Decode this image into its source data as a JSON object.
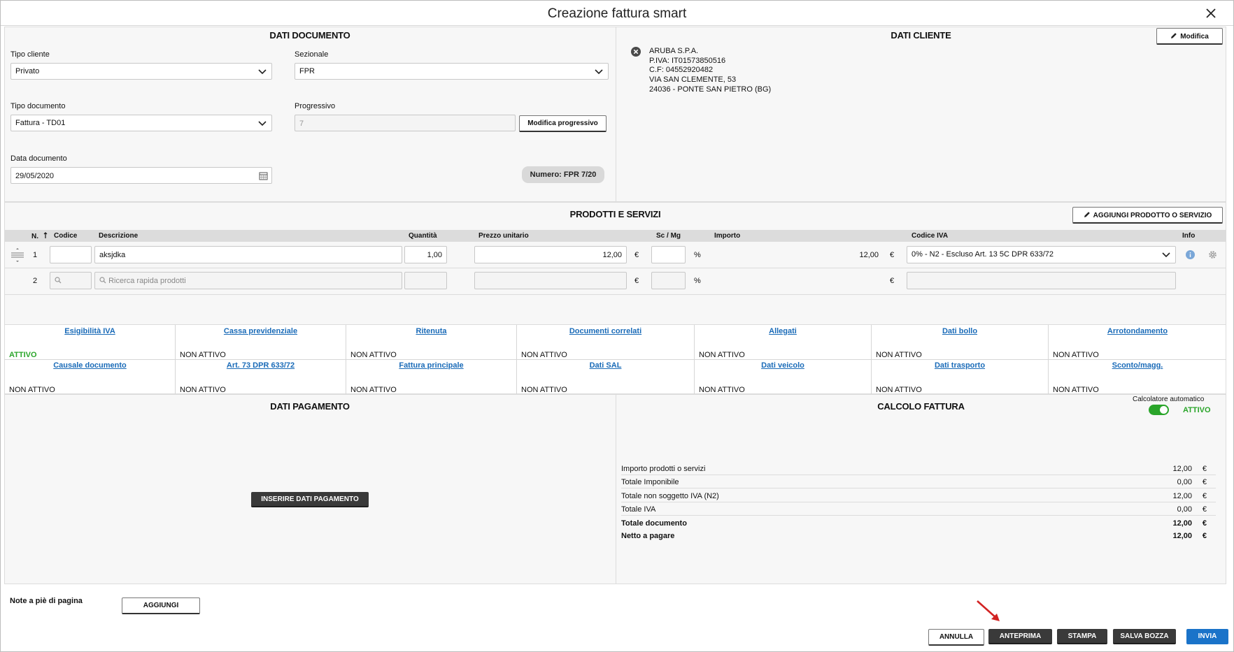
{
  "window": {
    "title": "Creazione fattura smart"
  },
  "documento": {
    "title": "DATI DOCUMENTO",
    "tipo_cliente_label": "Tipo cliente",
    "tipo_cliente_value": "Privato",
    "sezionale_label": "Sezionale",
    "sezionale_value": "FPR",
    "tipo_documento_label": "Tipo documento",
    "tipo_documento_value": "Fattura - TD01",
    "progressivo_label": "Progressivo",
    "progressivo_value": "7",
    "modifica_progressivo_label": "Modifica progressivo",
    "data_documento_label": "Data documento",
    "data_documento_value": "29/05/2020",
    "numero_label": "Numero: FPR 7/20"
  },
  "cliente": {
    "title": "DATI CLIENTE",
    "modifica_label": "Modifica",
    "lines": [
      "ARUBA S.P.A.",
      "P.IVA: IT01573850516",
      "C.F: 04552920482",
      "VIA SAN CLEMENTE, 53",
      "24036 - PONTE SAN PIETRO (BG)"
    ]
  },
  "prodotti": {
    "title": "PRODOTTI E SERVIZI",
    "aggiungi_label": "AGGIUNGI PRODOTTO O SERVIZIO",
    "headers": {
      "n": "N.",
      "codice": "Codice",
      "descrizione": "Descrizione",
      "quantita": "Quantità",
      "prezzo": "Prezzo unitario",
      "sc": "Sc / Mg",
      "importo": "Importo",
      "codice_iva": "Codice IVA",
      "info": "Info"
    },
    "rows": [
      {
        "n": "1",
        "codice": "",
        "descrizione": "aksjdka",
        "quantita": "1,00",
        "prezzo": "12,00",
        "euro": "€",
        "sc": "",
        "percent": "%",
        "importo": "12,00",
        "codice_iva": "0% - N2 - Escluso Art. 13 5C DPR 633/72"
      },
      {
        "n": "2",
        "descrizione_placeholder": "Ricerca rapida prodotti",
        "euro": "€",
        "percent": "%"
      }
    ]
  },
  "opzioni": {
    "row1": [
      {
        "label": "Esigibilità IVA",
        "status": "ATTIVO"
      },
      {
        "label": "Cassa previdenziale",
        "status": "NON ATTIVO"
      },
      {
        "label": "Ritenuta",
        "status": "NON ATTIVO"
      },
      {
        "label": "Documenti correlati",
        "status": "NON ATTIVO"
      },
      {
        "label": "Allegati",
        "status": "NON ATTIVO"
      },
      {
        "label": "Dati bollo",
        "status": "NON ATTIVO"
      },
      {
        "label": "Arrotondamento",
        "status": "NON ATTIVO"
      }
    ],
    "row2": [
      {
        "label": "Causale documento",
        "status": "NON ATTIVO"
      },
      {
        "label": "Art. 73 DPR 633/72",
        "status": "NON ATTIVO"
      },
      {
        "label": "Fattura principale",
        "status": "NON ATTIVO"
      },
      {
        "label": "Dati SAL",
        "status": "NON ATTIVO"
      },
      {
        "label": "Dati veicolo",
        "status": "NON ATTIVO"
      },
      {
        "label": "Dati trasporto",
        "status": "NON ATTIVO"
      },
      {
        "label": "Sconto/magg.",
        "status": "NON ATTIVO"
      }
    ]
  },
  "pagamento": {
    "title": "DATI PAGAMENTO",
    "inserire_label": "INSERIRE DATI PAGAMENTO"
  },
  "calcolo": {
    "title": "CALCOLO FATTURA",
    "calcolatore_label": "Calcolatore automatico",
    "calcolatore_status": "ATTIVO",
    "rows": [
      {
        "label": "Importo prodotti o servizi",
        "value": "12,00",
        "cur": "€"
      },
      {
        "label": "Totale Imponibile",
        "value": "0,00",
        "cur": "€"
      },
      {
        "label": "Totale non soggetto IVA (N2)",
        "value": "12,00",
        "cur": "€"
      },
      {
        "label": "Totale IVA",
        "value": "0,00",
        "cur": "€"
      },
      {
        "label": "Totale documento",
        "value": "12,00",
        "cur": "€"
      },
      {
        "label": "Netto a pagare",
        "value": "12,00",
        "cur": "€"
      }
    ]
  },
  "footer": {
    "note_label": "Note a piè di pagina",
    "aggiungi_label": "AGGIUNGI",
    "annulla": "ANNULLA",
    "anteprima": "ANTEPRIMA",
    "stampa": "STAMPA",
    "salva_bozza": "SALVA BOZZA",
    "invia": "INVIA"
  },
  "colors": {
    "accent_blue": "#1a73c9",
    "link_blue": "#1a6bb8",
    "active_green": "#2aa52a",
    "arrow_red": "#d22323",
    "dark_button": "#3a3a3a"
  }
}
